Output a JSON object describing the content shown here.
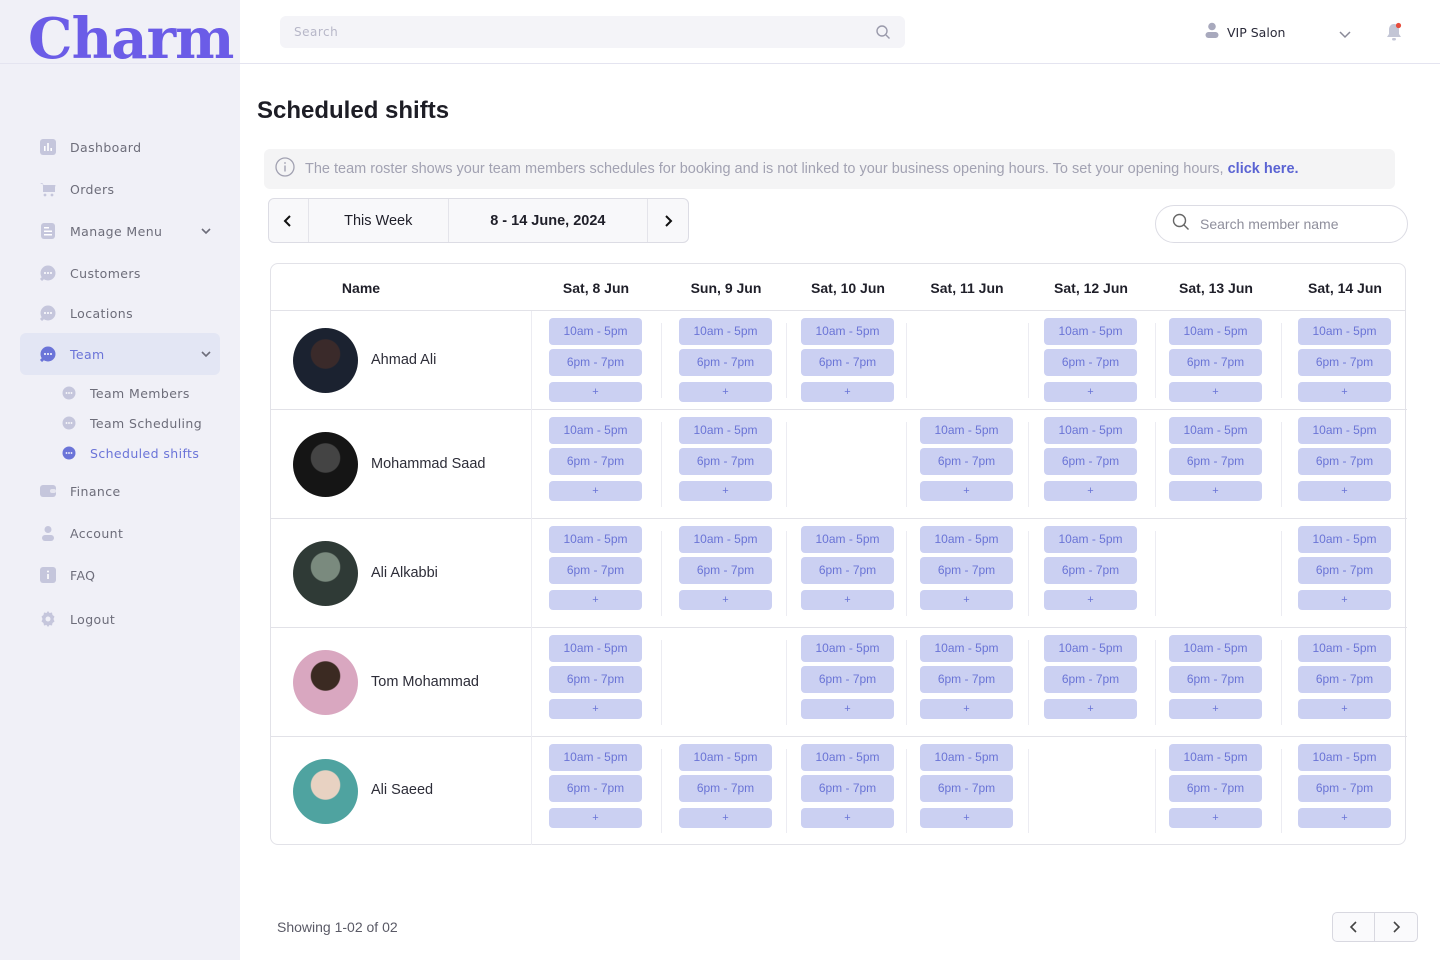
{
  "brand": {
    "logo_text": "Charm",
    "accent": "#6b5ce7"
  },
  "header": {
    "search_placeholder": "Search",
    "user_label": "VIP Salon",
    "notification_dot_color": "#e74c3c"
  },
  "sidebar": {
    "items": [
      {
        "label": "Dashboard",
        "icon": "dashboard-icon"
      },
      {
        "label": "Orders",
        "icon": "cart-icon"
      },
      {
        "label": "Manage Menu",
        "icon": "menu-icon",
        "expandable": true
      },
      {
        "label": "Customers",
        "icon": "chat-icon"
      },
      {
        "label": "Locations",
        "icon": "chat-icon"
      },
      {
        "label": "Team",
        "icon": "chat-icon",
        "expandable": true,
        "active": true
      },
      {
        "label": "Finance",
        "icon": "wallet-icon"
      },
      {
        "label": "Account",
        "icon": "user-icon"
      },
      {
        "label": "FAQ",
        "icon": "info-icon"
      },
      {
        "label": "Logout",
        "icon": "gear-icon"
      }
    ],
    "team_sub_items": [
      {
        "label": "Team Members"
      },
      {
        "label": "Team Scheduling"
      },
      {
        "label": "Scheduled shifts",
        "active": true
      }
    ]
  },
  "main": {
    "title": "Scheduled shifts",
    "info": {
      "text": "The team roster shows your team members schedules for booking and is not linked to your business opening hours. To set your opening hours, ",
      "link": "click here."
    },
    "week_nav": {
      "this_week_label": "This Week",
      "range_label": "8 - 14 June, 2024"
    },
    "member_search_placeholder": "Search member name",
    "table": {
      "name_header": "Name",
      "days": [
        "Sat, 8 Jun",
        "Sun, 9 Jun",
        "Sat, 10 Jun",
        "Sat, 11 Jun",
        "Sat, 12 Jun",
        "Sat, 13 Jun",
        "Sat, 14 Jun"
      ],
      "shift_labels": [
        "10am - 5pm",
        "6pm - 7pm"
      ],
      "add_label": "+",
      "members": [
        {
          "name": "Ahmad Ali",
          "schedule": [
            true,
            true,
            true,
            false,
            true,
            true,
            true
          ]
        },
        {
          "name": "Mohammad Saad",
          "schedule": [
            true,
            true,
            false,
            true,
            true,
            true,
            true
          ]
        },
        {
          "name": "Ali Alkabbi",
          "schedule": [
            true,
            true,
            true,
            true,
            true,
            false,
            true
          ]
        },
        {
          "name": "Tom Mohammad",
          "schedule": [
            true,
            false,
            true,
            true,
            true,
            true,
            true
          ]
        },
        {
          "name": "Ali Saeed",
          "schedule": [
            true,
            true,
            true,
            true,
            false,
            true,
            true
          ]
        }
      ]
    },
    "pagination": {
      "showing_text": "Showing 1-02 of 02"
    }
  }
}
